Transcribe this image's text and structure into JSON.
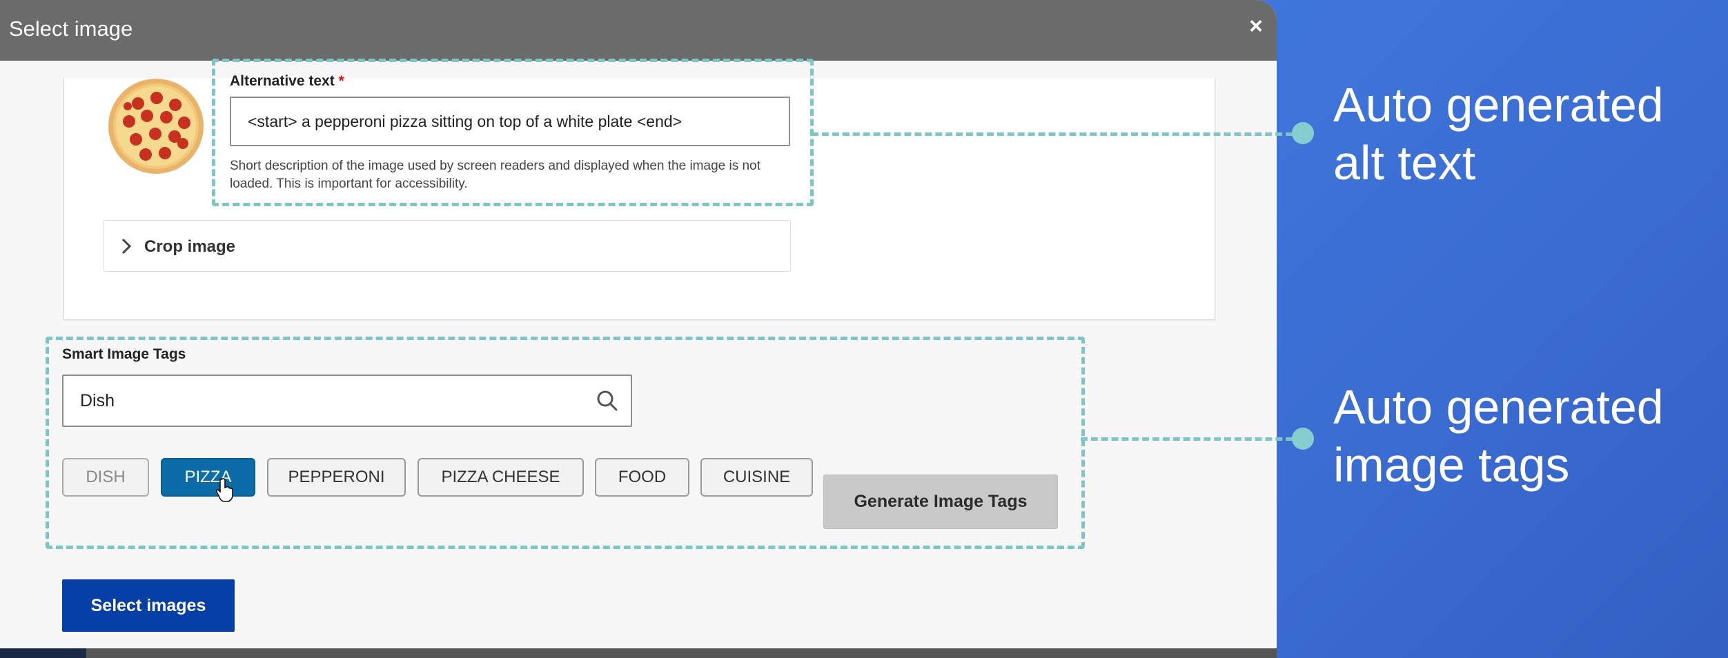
{
  "dialog": {
    "title": "Select image",
    "close_glyph": "×"
  },
  "alt_text": {
    "label": "Alternative text",
    "required_mark": "*",
    "value": "<start> a pepperoni pizza sitting on top of a white plate <end>",
    "help": "Short description of the image used by screen readers and displayed when the image is not loaded. This is important for accessibility."
  },
  "crop": {
    "label": "Crop image"
  },
  "tags": {
    "label": "Smart Image Tags",
    "search_value": "Dish",
    "chips": [
      {
        "label": "DISH",
        "state": "disabled"
      },
      {
        "label": "PIZZA",
        "state": "selected"
      },
      {
        "label": "PEPPERONI",
        "state": "normal"
      },
      {
        "label": "PIZZA CHEESE",
        "state": "normal"
      },
      {
        "label": "FOOD",
        "state": "normal"
      },
      {
        "label": "CUISINE",
        "state": "normal"
      }
    ],
    "generate_label": "Generate Image Tags"
  },
  "footer": {
    "select_label": "Select images"
  },
  "callouts": {
    "alt": {
      "line1": "Auto generated",
      "line2": "alt text"
    },
    "tags": {
      "line1": "Auto generated",
      "line2": "image tags"
    }
  },
  "colors": {
    "accent_blue": "#063fa6",
    "chip_selected": "#0b6ca8",
    "highlight_dash": "#7ec6c6",
    "background_blue": "#3d6fd2"
  },
  "icons": {
    "close": "close-icon",
    "search": "search-icon",
    "chevron": "chevron-right-icon",
    "cursor": "hand-pointer-icon"
  }
}
